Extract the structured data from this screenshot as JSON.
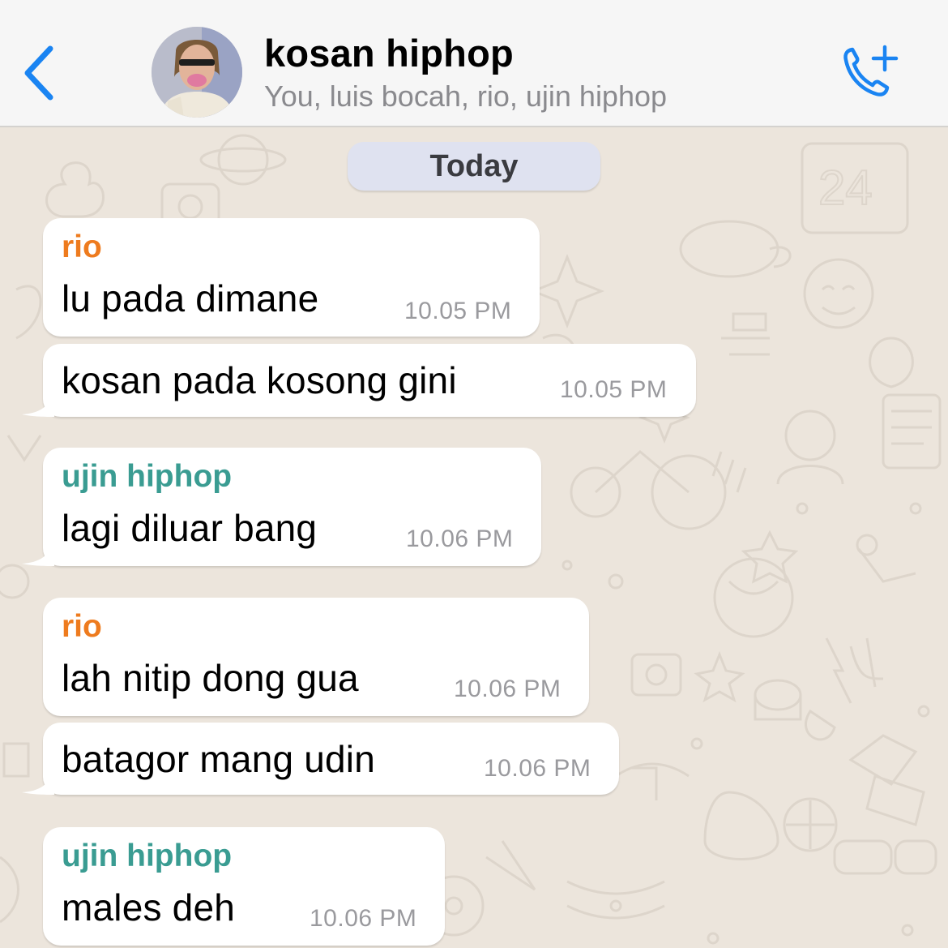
{
  "header": {
    "title": "kosan hiphop",
    "members": "You, luis bocah, rio, ujin hiphop",
    "icons": {
      "back": "chevron-left-icon",
      "call": "add-call-icon"
    },
    "accent": "#1a84f2"
  },
  "chat": {
    "date_label": "Today",
    "sender_colors": {
      "rio": "#ee7b1e",
      "ujin hiphop": "#3a9c92"
    },
    "messages": [
      {
        "sender": "rio",
        "text": "lu pada dimane",
        "time": "10.05 PM"
      },
      {
        "sender": "",
        "text": "kosan pada kosong gini",
        "time": "10.05 PM"
      },
      {
        "sender": "ujin hiphop",
        "text": "lagi diluar bang",
        "time": "10.06 PM"
      },
      {
        "sender": "rio",
        "text": "lah nitip dong gua",
        "time": "10.06 PM"
      },
      {
        "sender": "",
        "text": "batagor mang udin",
        "time": "10.06 PM"
      },
      {
        "sender": "ujin hiphop",
        "text": "males deh",
        "time": "10.06 PM"
      }
    ]
  }
}
